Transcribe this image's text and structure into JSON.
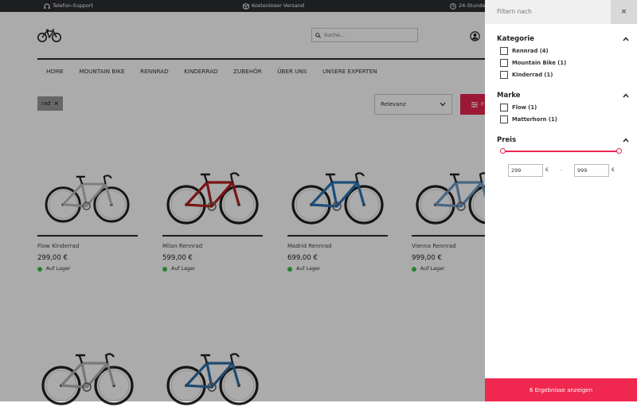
{
  "topbar": {
    "support": "Telefon-Support",
    "shipping": "Kostenloser Versand",
    "delivery": "24-Stunde"
  },
  "search": {
    "placeholder": "Suche..."
  },
  "nav": {
    "items": [
      "HOME",
      "MOUNTAIN BIKE",
      "RENNRAD",
      "KINDERRAD",
      "ZUBEHÖR",
      "ÜBER UNS",
      "UNSERE EXPERTEN"
    ]
  },
  "active_filter": {
    "label": "rad",
    "remove": "×"
  },
  "sort": {
    "selected": "Relevanz"
  },
  "filter_button": {
    "label": "F"
  },
  "products": [
    {
      "name": "Flow Kinderrad",
      "price": "299,00 €",
      "stock": "Auf Lager",
      "frame_color": "#b8bcc0"
    },
    {
      "name": "Milan Rennrad",
      "price": "599,00 €",
      "stock": "Auf Lager",
      "frame_color": "#b3201d"
    },
    {
      "name": "Madrid Rennrad",
      "price": "699,00 €",
      "stock": "Auf Lager",
      "frame_color": "#2b73b8"
    },
    {
      "name": "Vienna Rennrad",
      "price": "999,00 €",
      "stock": "Auf Lager",
      "frame_color": "#6f98c4"
    },
    {
      "name": "",
      "price": "",
      "stock": "",
      "frame_color": "#b0b4b8"
    },
    {
      "name": "",
      "price": "",
      "stock": "",
      "frame_color": "#2f6fa8"
    }
  ],
  "panel": {
    "title": "Filtern nach",
    "close": "×",
    "categories": {
      "title": "Kategorie",
      "options": [
        "Rennrad (4)",
        "Mountain Bike (1)",
        "Kinderrad (1)"
      ]
    },
    "brand": {
      "title": "Marke",
      "options": [
        "Flow (1)",
        "Matterhorn (1)"
      ]
    },
    "price": {
      "title": "Preis",
      "min": "299",
      "max": "999",
      "currency": "€",
      "separator": "-"
    },
    "show_results": "6 Ergebnisse anzeigen"
  },
  "colors": {
    "accent": "#e8264f",
    "topbar": "#2a2d30",
    "in_stock": "#3cc24b"
  }
}
